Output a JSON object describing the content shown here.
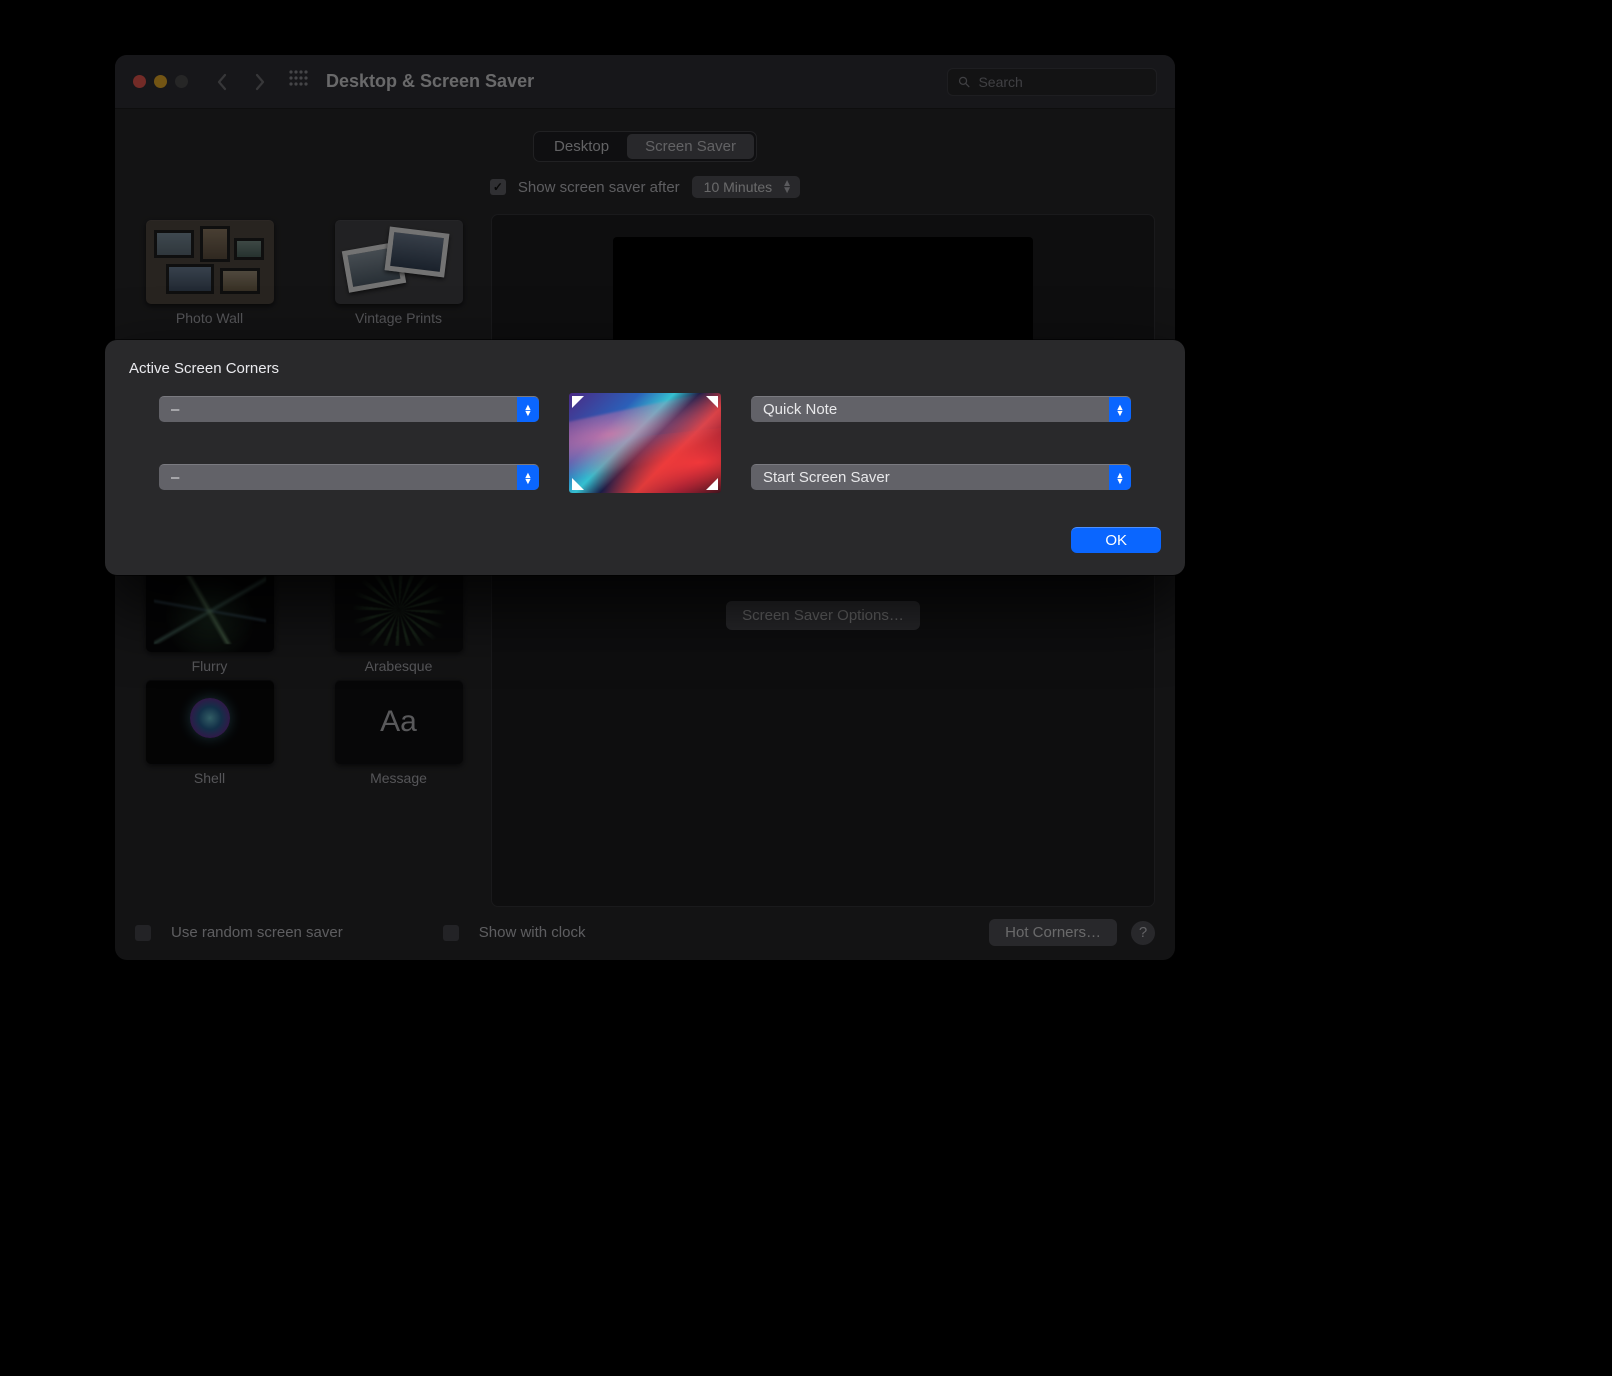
{
  "window": {
    "title": "Desktop & Screen Saver",
    "search_placeholder": "Search"
  },
  "tabs": {
    "desktop": "Desktop",
    "screensaver": "Screen Saver"
  },
  "after": {
    "label": "Show screen saver after",
    "value": "10 Minutes"
  },
  "savers": {
    "photo_wall": "Photo Wall",
    "vintage_prints": "Vintage Prints",
    "flurry": "Flurry",
    "arabesque": "Arabesque",
    "shell": "Shell",
    "message": "Message",
    "message_glyph": "Aa"
  },
  "preview": {
    "options_btn": "Screen Saver Options…"
  },
  "footer": {
    "random": "Use random screen saver",
    "clock": "Show with clock",
    "hot_corners": "Hot Corners…",
    "help": "?"
  },
  "sheet": {
    "title": "Active Screen Corners",
    "tl": "–",
    "bl": "–",
    "tr": "Quick Note",
    "br": "Start Screen Saver",
    "ok": "OK"
  }
}
